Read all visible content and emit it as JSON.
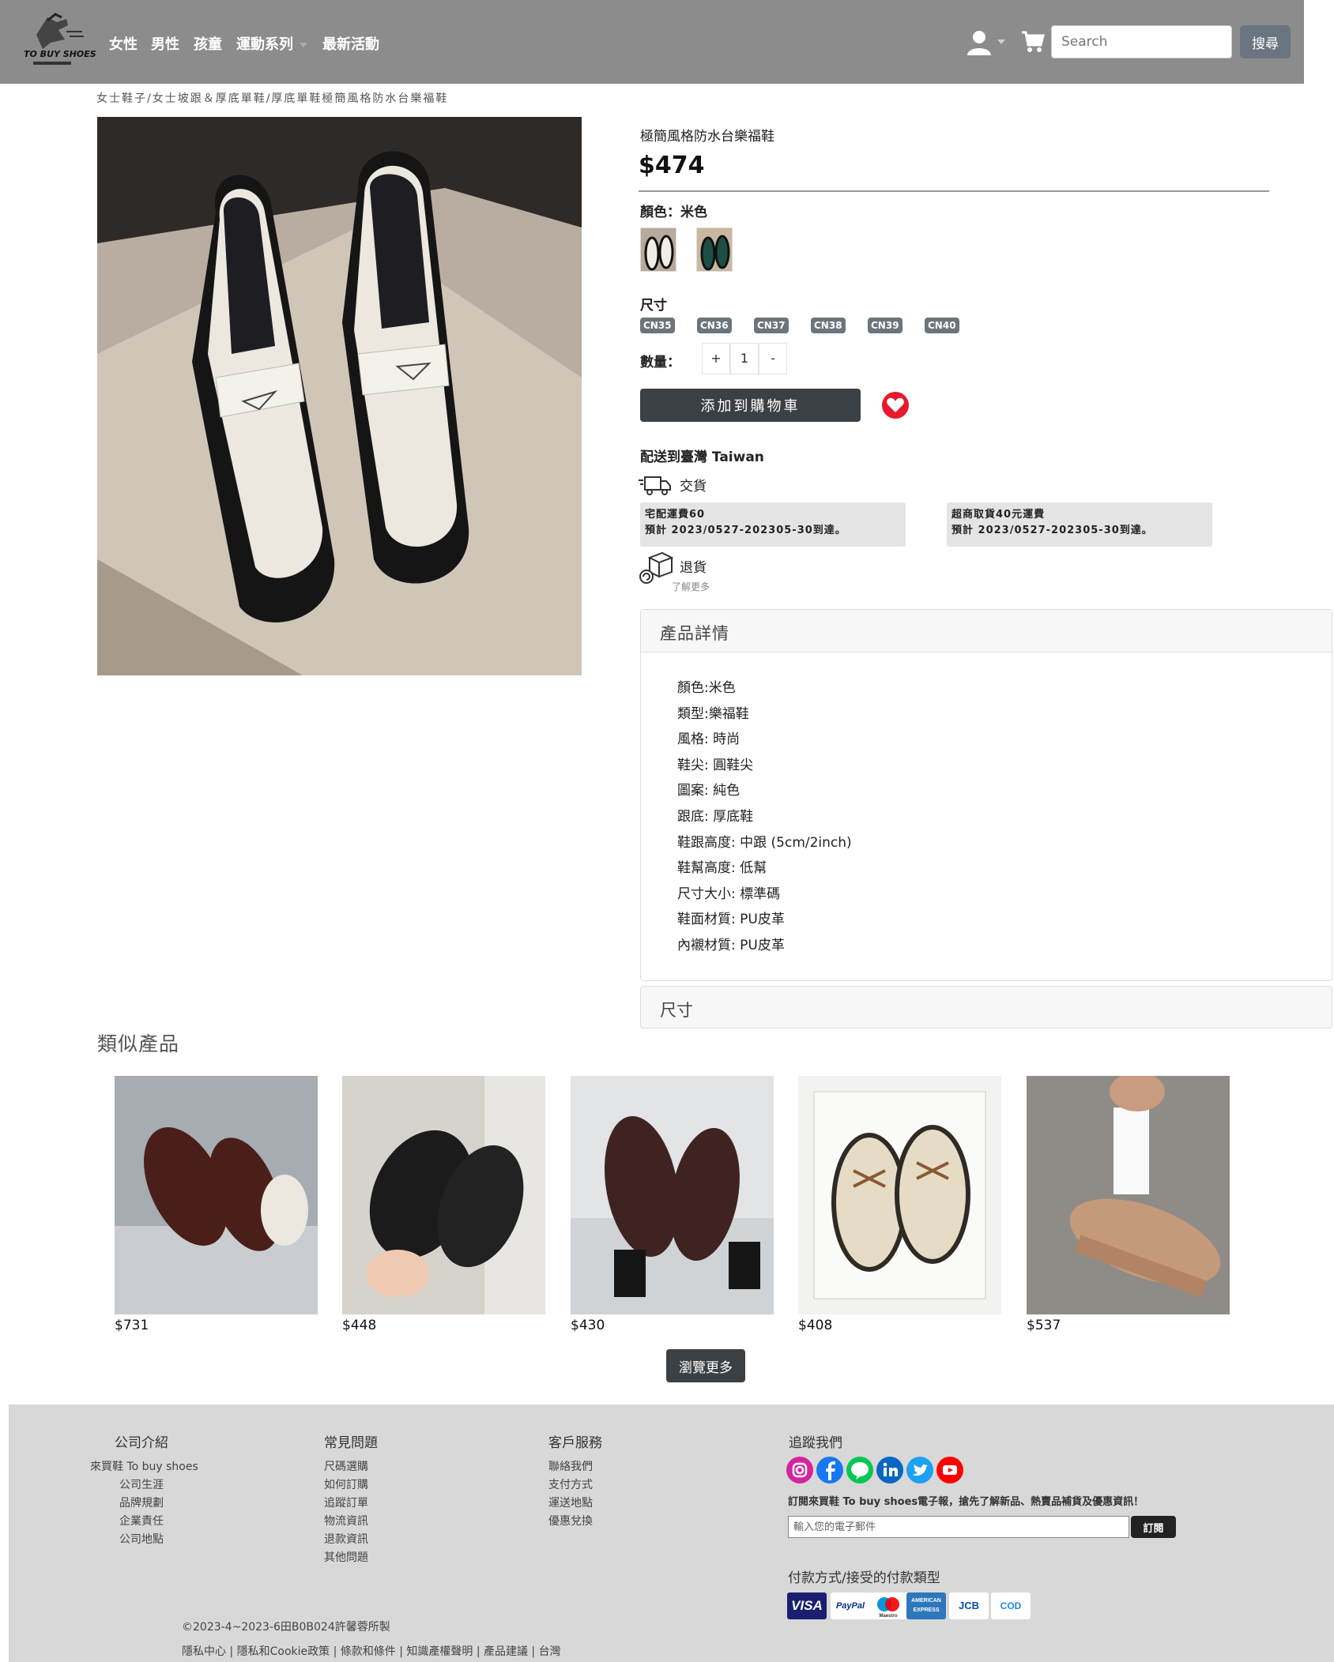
{
  "nav": {
    "logo_text": "TO BUY SHOES",
    "links": [
      "女性",
      "男性",
      "孩童",
      "運動系列",
      "最新活動"
    ],
    "search_placeholder": "Search",
    "search_button": "搜尋"
  },
  "breadcrumb": "女士鞋子/女士坡跟＆厚底單鞋/厚底單鞋極簡風格防水台樂福鞋",
  "product": {
    "name": "極簡風格防水台樂福鞋",
    "price": "$474",
    "color_label": "顏色：米色",
    "size_label": "尺寸",
    "sizes": [
      "CN35",
      "CN36",
      "CN37",
      "CN38",
      "CN39",
      "CN40"
    ],
    "qty_label": "數量：",
    "qty_plus": "+",
    "qty_value": "1",
    "qty_minus": "-",
    "add_to_cart": "添加到購物車",
    "ship_title": "配送到臺灣 Taiwan",
    "delivery_label": "交貨",
    "ship_home": {
      "line1": "宅配運費60",
      "line2": "預計 2023/0527-202305-30到達。"
    },
    "ship_store": {
      "line1": "超商取貨40元運費",
      "line2": "預計 2023/0527-202305-30到達。"
    },
    "return_label": "退貨",
    "learn_more": "了解更多"
  },
  "details": {
    "title": "產品詳情",
    "items": [
      "顏色:米色",
      "類型:樂福鞋",
      "風格: 時尚",
      "鞋尖: 圓鞋尖",
      "圖案: 純色",
      "跟底: 厚底鞋",
      "鞋跟高度: 中跟 (5cm/2inch)",
      "鞋幫高度: 低幫",
      "尺寸大小: 標準碼",
      "鞋面材質: PU皮革",
      "內襯材質: PU皮革"
    ]
  },
  "size_panel_title": "尺寸",
  "similar": {
    "title": "類似產品",
    "items": [
      {
        "price": "$731"
      },
      {
        "price": "$448"
      },
      {
        "price": "$430"
      },
      {
        "price": "$408"
      },
      {
        "price": "$537"
      }
    ],
    "browse_more": "瀏覽更多"
  },
  "footer": {
    "company": {
      "title": "公司介紹",
      "links": [
        "來買鞋 To buy shoes",
        "公司生涯",
        "品牌規劃",
        "企業責任",
        "公司地點"
      ]
    },
    "faq": {
      "title": "常見問題",
      "links": [
        "尺碼選購",
        "如何訂購",
        "追蹤訂單",
        "物流資訊",
        "退款資訊",
        "其他問題"
      ]
    },
    "service": {
      "title": "客戶服務",
      "links": [
        "聯絡我們",
        "支付方式",
        "運送地點",
        "優惠兌換"
      ]
    },
    "follow": {
      "title": "追蹤我們"
    },
    "subscribe_text": "訂閱來買鞋 To buy shoes電子報，搶先了解新品、熱賣品補貨及優惠資訊！",
    "email_placeholder": "輸入您的電子郵件",
    "subscribe_button": "訂閱",
    "payment_title": "付款方式/接受的付款類型",
    "payments": [
      "VISA",
      "PayPal",
      "Maestro",
      "AMERICAN EXPRESS",
      "JCB",
      "COD"
    ],
    "copyright": "©2023-4~2023-6田B0B024許馨蓉所製",
    "legal": "隱私中心 | 隱私和Cookie政策 | 條款和條件 | 知識產權聲明 | 產品建議 | 台灣"
  }
}
